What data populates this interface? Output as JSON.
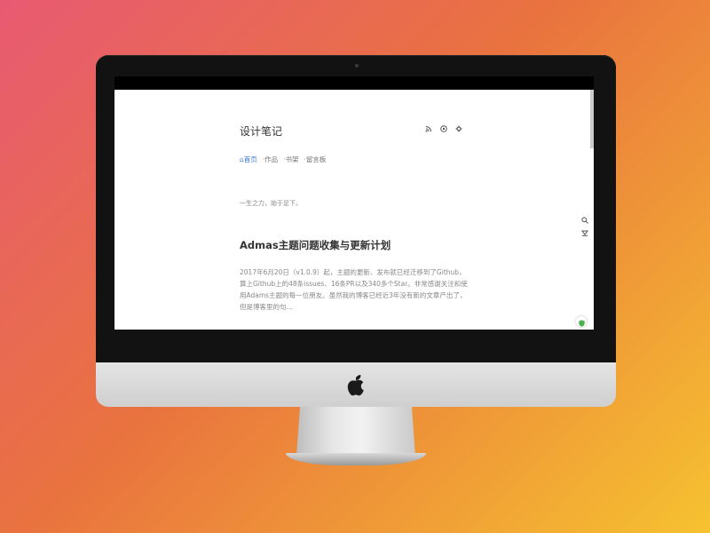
{
  "site": {
    "title": "设计笔记",
    "tagline": "一生之力，始于足下。"
  },
  "header_icons": [
    "rss-icon",
    "github-icon",
    "settings-icon"
  ],
  "nav": {
    "items": [
      {
        "label": "⌂首页",
        "active": true
      },
      {
        "label": "·作品",
        "active": false
      },
      {
        "label": "·书架",
        "active": false
      },
      {
        "label": "·留言板",
        "active": false
      }
    ]
  },
  "post": {
    "title": "Admas主题问题收集与更新计划",
    "excerpt": "2017年6月20日（v1.0.9）起，主题的更新、发布就已经迁移到了Github，算上Github上的48条issues、16条PR以及340多个Star。非常感谢关注和使用Adams主题的每一位朋友。虽然我的博客已经近3年没有新的文章产出了，但是博客里的句…"
  },
  "side_icons": [
    "search-icon",
    "download-icon"
  ],
  "colors": {
    "accent": "#3a7bd5",
    "badge": "#4caf50"
  }
}
